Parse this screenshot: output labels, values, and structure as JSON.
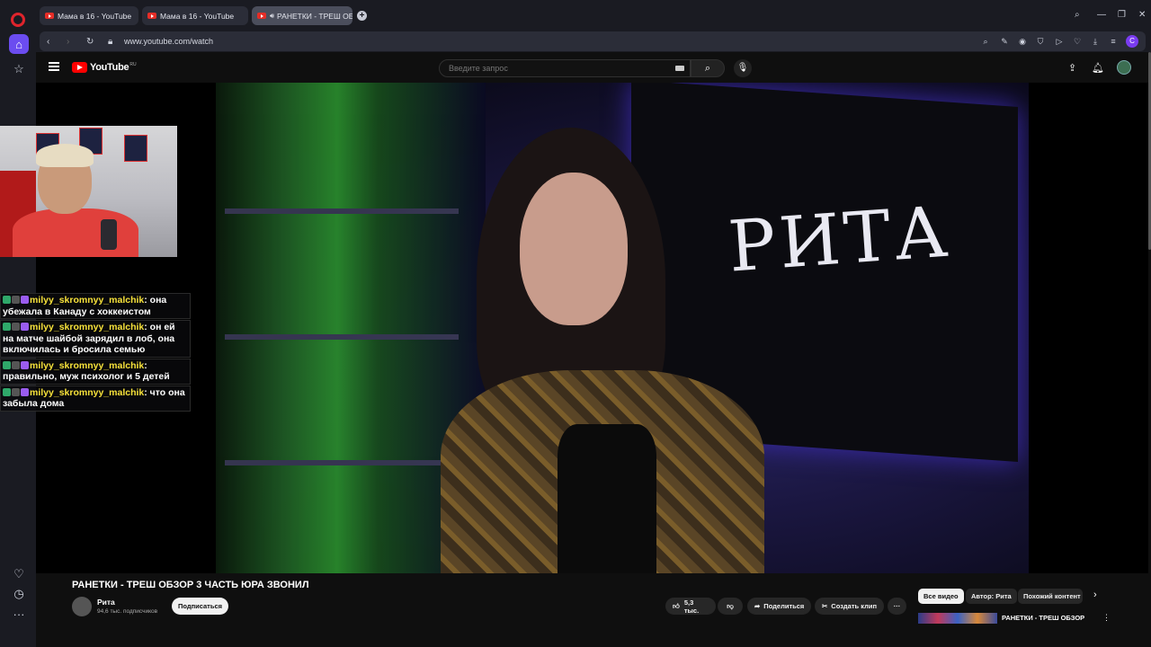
{
  "browser": {
    "tabs": [
      {
        "title": "Мама в 16 - YouTube",
        "active": false
      },
      {
        "title": "Мама в 16 - YouTube",
        "active": false
      },
      {
        "title": "РАНЕТКИ - ТРЕШ ОБ",
        "active": true
      }
    ],
    "url": "www.youtube.com/watch",
    "profile_initial": "C",
    "accent_color": "#6b4cf0"
  },
  "youtube": {
    "logo_text": "YouTube",
    "logo_region": "RU",
    "search_placeholder": "Введите запрос"
  },
  "video": {
    "overlay_sign": "РИТА",
    "title": "РАНЕТКИ - ТРЕШ ОБЗОР 3 ЧАСТЬ ЮРА ЗВОНИЛ",
    "channel_name": "Рита",
    "subscribers": "94,6 тыс. подписчиков",
    "subscribe_label": "Подписаться",
    "likes": "5,3 тыс.",
    "share_label": "Поделиться",
    "clip_label": "Создать клип"
  },
  "chips": [
    {
      "label": "Все видео",
      "active": true
    },
    {
      "label": "Автор: Рита",
      "active": false
    },
    {
      "label": "Похожий контент",
      "active": false
    }
  ],
  "recommendation": {
    "title": "РАНЕТКИ - ТРЕШ ОБЗОР"
  },
  "chat": [
    {
      "user": "milyy_skromnyy_malchik",
      "text": "она убежала в Канаду с хоккеистом"
    },
    {
      "user": "milyy_skromnyy_malchik",
      "text": "он ей на матче шайбой зарядил в лоб, она включилась и бросила семью"
    },
    {
      "user": "milyy_skromnyy_malchik",
      "text": "правильно, муж психолог и 5 детей"
    },
    {
      "user": "milyy_skromnyy_malchik",
      "text": "что она забыла дома"
    }
  ]
}
